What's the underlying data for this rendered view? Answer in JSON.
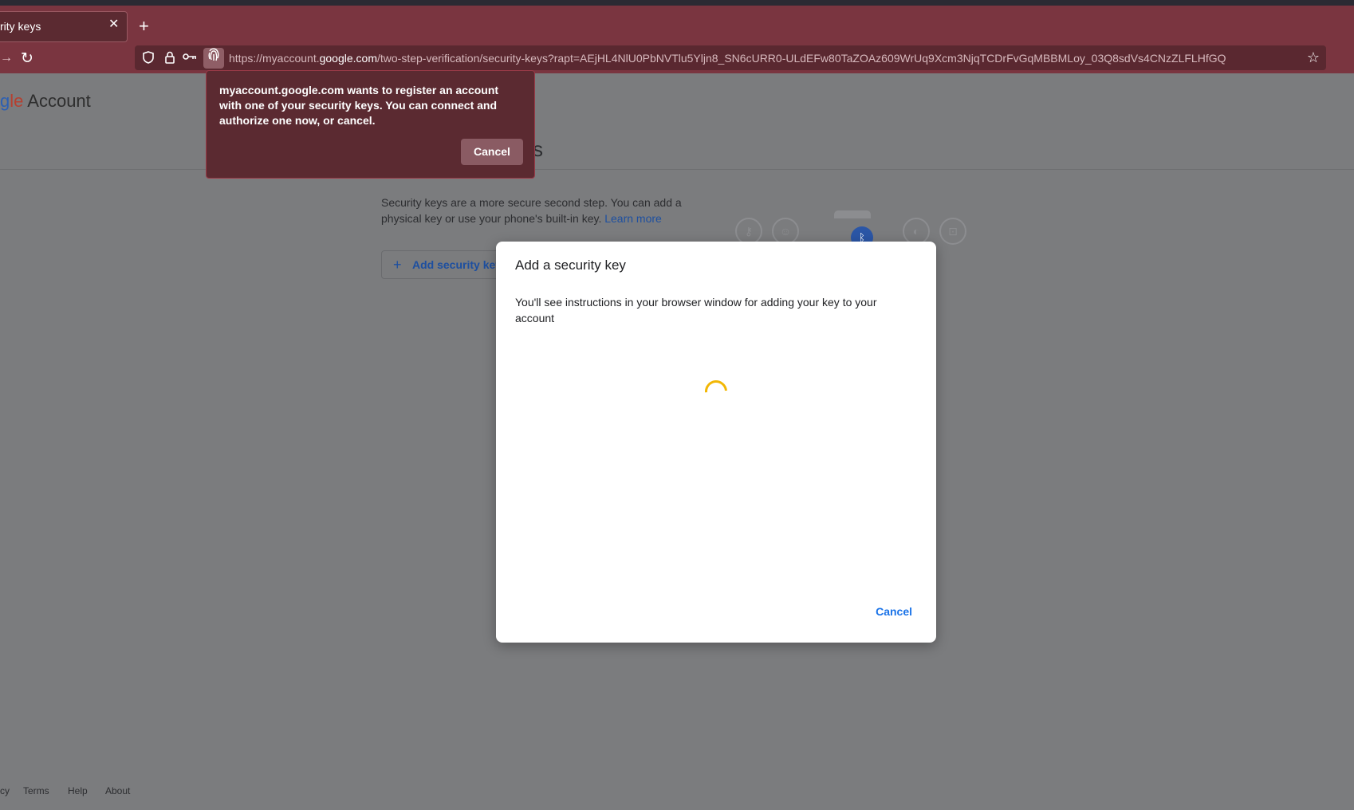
{
  "browser": {
    "tab_title": "rity keys",
    "tab_close": "✕",
    "new_tab": "+",
    "url_prefix": "https://myaccount.",
    "url_host": "google.com",
    "url_path": "/two-step-verification/security-keys?rapt=AEjHL4NlU0PbNVTlu5Yljn8_SN6cURR0-ULdEFw80TaZOAz609WrUq9Xcm3NjqTCDrFvGqMBBMLoy_03Q8sdVs4CNzZLFLHfGQ"
  },
  "popup": {
    "message": "myaccount.google.com wants to register an account with one of your security keys. You can connect and authorize one now, or cancel.",
    "cancel_label": "Cancel"
  },
  "page": {
    "logo_partial_colored": "gle",
    "logo_account": "Account",
    "title_tail": "s",
    "description": "Security keys are a more secure second step. You can add a physical key or use your phone's built-in key.",
    "learn_more": "Learn more",
    "add_key_label": "Add security key"
  },
  "dialog": {
    "title": "Add a security key",
    "body": "You'll see instructions in your browser window for adding your key to your account",
    "cancel_label": "Cancel"
  },
  "footer": {
    "privacy_partial": "cy",
    "terms": "Terms",
    "help": "Help",
    "about": "About"
  },
  "colors": {
    "chrome_accent": "#7a3540",
    "dialog_link": "#1a73e8",
    "spinner": "#f2b705"
  }
}
